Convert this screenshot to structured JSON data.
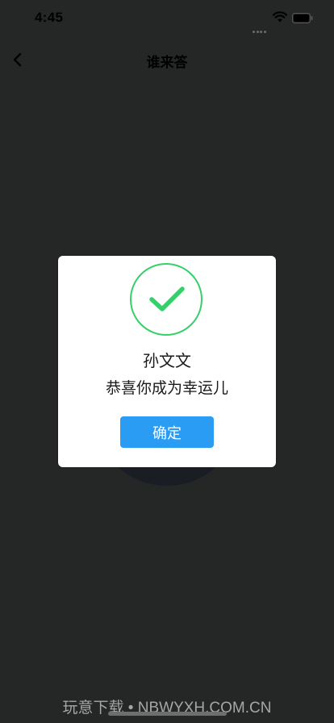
{
  "status_bar": {
    "time": "4:45"
  },
  "nav": {
    "title": "谁来答"
  },
  "modal": {
    "winner_name": "孙文文",
    "message": "恭喜你成为幸运儿",
    "confirm_label": "确定"
  },
  "watermark": "玩意下载 • NBWYXH.COM.CN",
  "colors": {
    "overlay_background": "#252626",
    "success_green": "#36d06a",
    "button_blue": "#2a9cf3",
    "modal_background": "#ffffff"
  }
}
